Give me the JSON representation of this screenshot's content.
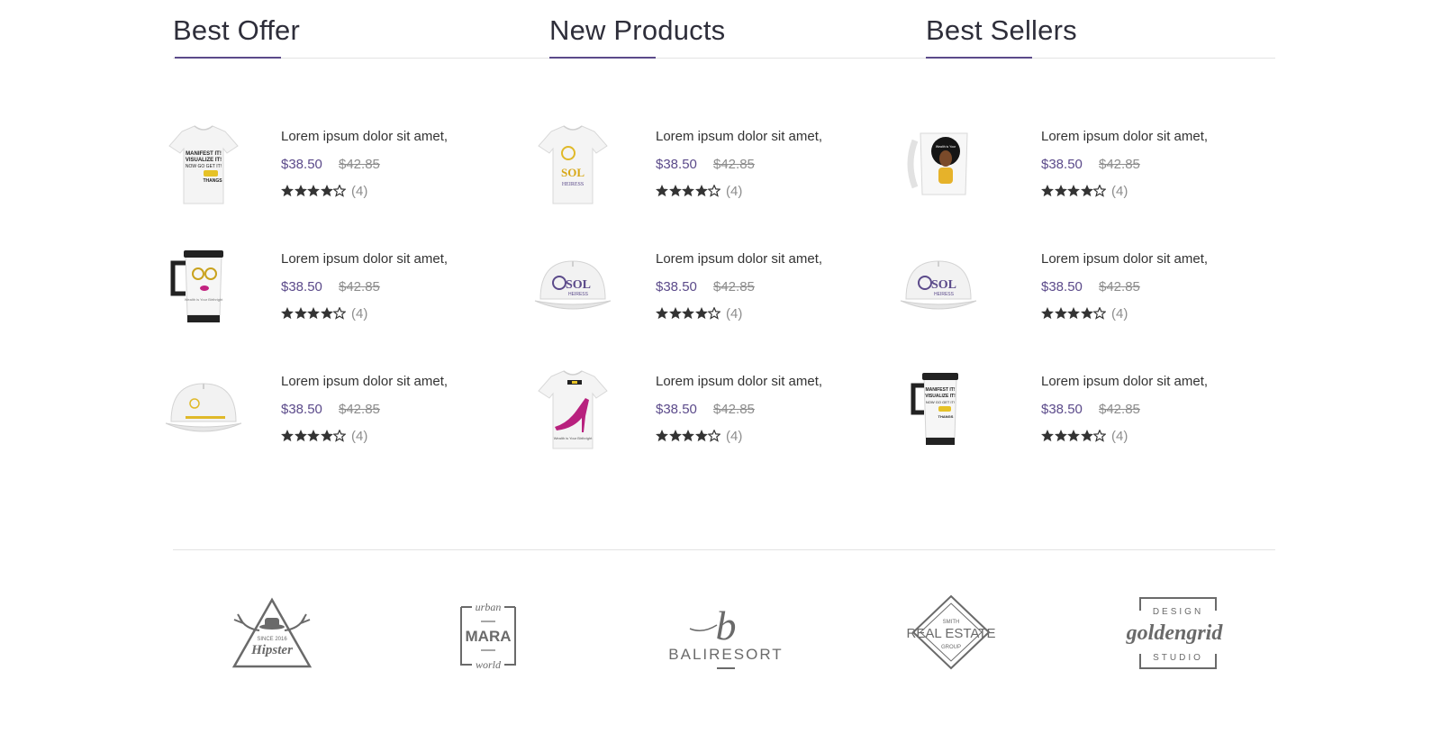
{
  "colors": {
    "accent": "#5b4a8a",
    "text": "#333333",
    "muted": "#8d8d8d",
    "star": "#333333"
  },
  "columns": [
    {
      "title": "Best Offer",
      "products": [
        {
          "image": "tshirt-manifest",
          "title": "Lorem ipsum dolor sit amet,",
          "price": "$38.50",
          "old_price": "$42.85",
          "rating": 4,
          "reviews": "(4)"
        },
        {
          "image": "travel-mug-face",
          "title": "Lorem ipsum dolor sit amet,",
          "price": "$38.50",
          "old_price": "$42.85",
          "rating": 4,
          "reviews": "(4)"
        },
        {
          "image": "cap-wealth",
          "title": "Lorem ipsum dolor sit amet,",
          "price": "$38.50",
          "old_price": "$42.85",
          "rating": 4,
          "reviews": "(4)"
        }
      ]
    },
    {
      "title": "New Products",
      "products": [
        {
          "image": "tshirt-sol-heiress",
          "title": "Lorem ipsum dolor sit amet,",
          "price": "$38.50",
          "old_price": "$42.85",
          "rating": 4,
          "reviews": "(4)"
        },
        {
          "image": "cap-sol-heiress",
          "title": "Lorem ipsum dolor sit amet,",
          "price": "$38.50",
          "old_price": "$42.85",
          "rating": 4,
          "reviews": "(4)"
        },
        {
          "image": "tshirt-heel",
          "title": "Lorem ipsum dolor sit amet,",
          "price": "$38.50",
          "old_price": "$42.85",
          "rating": 4,
          "reviews": "(4)"
        }
      ]
    },
    {
      "title": "Best Sellers",
      "products": [
        {
          "image": "mug-woman",
          "title": "Lorem ipsum dolor sit amet,",
          "price": "$38.50",
          "old_price": "$42.85",
          "rating": 4,
          "reviews": "(4)"
        },
        {
          "image": "cap-sol-heiress",
          "title": "Lorem ipsum dolor sit amet,",
          "price": "$38.50",
          "old_price": "$42.85",
          "rating": 4,
          "reviews": "(4)"
        },
        {
          "image": "travel-mug-manifest",
          "title": "Lorem ipsum dolor sit amet,",
          "price": "$38.50",
          "old_price": "$42.85",
          "rating": 4,
          "reviews": "(4)"
        }
      ]
    }
  ],
  "brands": [
    {
      "name": "Hipster",
      "text": "Hipster",
      "sub": "SINCE 2016"
    },
    {
      "name": "Mara",
      "text": "MARA",
      "top": "urban",
      "bottom": "world"
    },
    {
      "name": "Bali Resort",
      "text": "BALIRESORT",
      "mark": "b"
    },
    {
      "name": "Real Estate",
      "text": "REAL ESTATE",
      "top": "SMITH",
      "bottom": "GROUP"
    },
    {
      "name": "Goldengrid",
      "text": "goldengrid",
      "top": "DESIGN",
      "bottom": "STUDIO"
    }
  ]
}
